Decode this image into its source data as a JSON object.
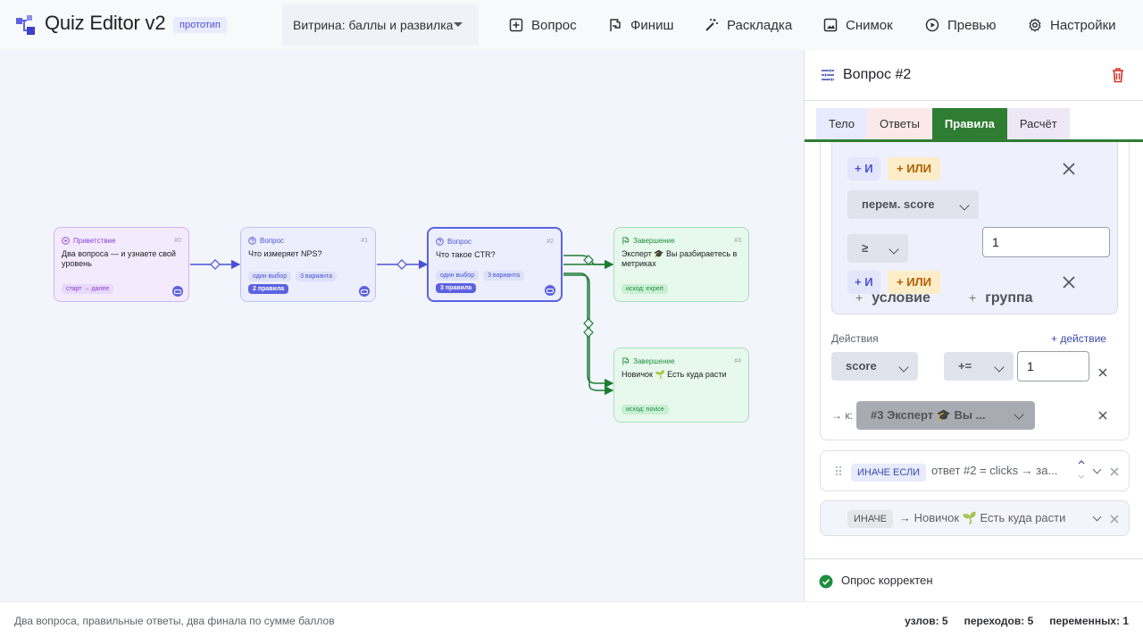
{
  "app": {
    "title": "Quiz Editor v2",
    "badge": "прототип"
  },
  "toolbar": {
    "showcase_value": "Витрина: баллы и развилка",
    "question": "Вопрос",
    "finish": "Финиш",
    "layout": "Раскладка",
    "snapshot": "Снимок",
    "preview": "Превью",
    "settings": "Настройки"
  },
  "nodes": [
    {
      "kind": "Приветствие",
      "num": "#0",
      "title": "Два вопроса — и узнаете свой уровень",
      "chips": [],
      "foot": "старт → далее"
    },
    {
      "kind": "Вопрос",
      "num": "#1",
      "title": "Что измеряет NPS?",
      "chips": [
        "один выбор",
        "3 варианта"
      ],
      "foot": "2 правила"
    },
    {
      "kind": "Вопрос",
      "num": "#2",
      "title": "Что такое CTR?",
      "chips": [
        "один выбор",
        "3 варианта"
      ],
      "foot": "3 правила"
    },
    {
      "kind": "Завершение",
      "num": "#3",
      "title": "Эксперт 🎓 Вы разбираетесь в метриках",
      "chips": [],
      "foot": "исход: expert"
    },
    {
      "kind": "Завершение",
      "num": "#4",
      "title": "Новичок 🌱 Есть куда расти",
      "chips": [],
      "foot": "исход: novice"
    }
  ],
  "panel": {
    "title": "Вопрос #2",
    "tabs": [
      "Тело",
      "Ответы",
      "Правила",
      "Расчёт"
    ],
    "conditions": {
      "and_label": "+ И",
      "or_label": "+ ИЛИ",
      "var_select": "перем. score",
      "op_select": "≥",
      "value": "1",
      "add_condition": "условие",
      "add_group": "группа"
    },
    "actions": {
      "label": "Действия",
      "add_action": "действие",
      "var_select": "score",
      "op_select": "+=",
      "value": "1",
      "to_label": "→ к:",
      "target": "#3 Эксперт 🎓 Вы ..."
    },
    "rules": [
      {
        "kind": "ИНАЧЕ ЕСЛИ",
        "text": "ответ #2 = clicks  →  за..."
      },
      {
        "kind": "ИНАЧЕ",
        "text": "→ Новичок 🌱 Есть куда расти"
      }
    ],
    "status": "Опрос корректен"
  },
  "footer": {
    "description": "Два вопроса, правильные ответы, два финала по сумме баллов",
    "nodes": "узлов: 5",
    "transitions": "переходов: 5",
    "variables": "переменных: 1"
  },
  "colors": {
    "accent": "#5c62e0",
    "green": "#2e7d32",
    "danger": "#d93025"
  }
}
